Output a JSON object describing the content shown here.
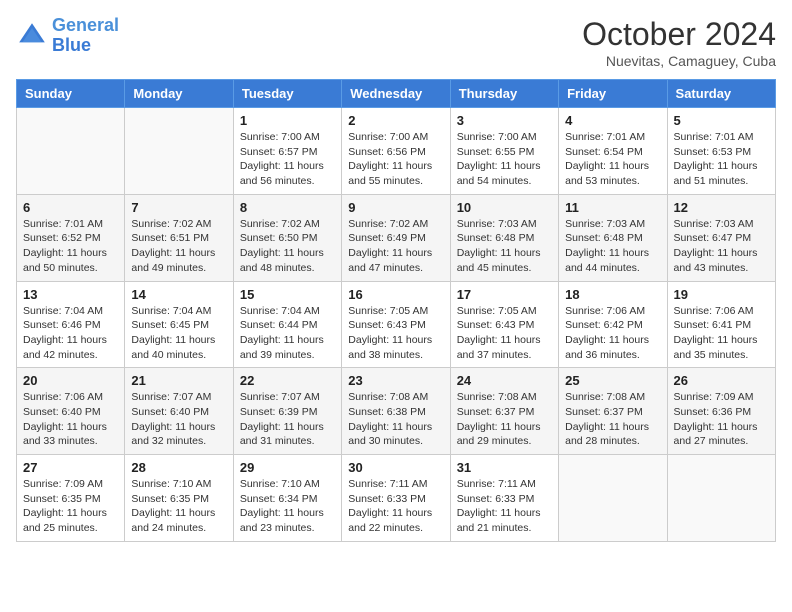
{
  "header": {
    "logo_line1": "General",
    "logo_line2": "Blue",
    "month": "October 2024",
    "location": "Nuevitas, Camaguey, Cuba"
  },
  "weekdays": [
    "Sunday",
    "Monday",
    "Tuesday",
    "Wednesday",
    "Thursday",
    "Friday",
    "Saturday"
  ],
  "weeks": [
    [
      {
        "day": "",
        "sunrise": "",
        "sunset": "",
        "daylight": ""
      },
      {
        "day": "",
        "sunrise": "",
        "sunset": "",
        "daylight": ""
      },
      {
        "day": "1",
        "sunrise": "Sunrise: 7:00 AM",
        "sunset": "Sunset: 6:57 PM",
        "daylight": "Daylight: 11 hours and 56 minutes."
      },
      {
        "day": "2",
        "sunrise": "Sunrise: 7:00 AM",
        "sunset": "Sunset: 6:56 PM",
        "daylight": "Daylight: 11 hours and 55 minutes."
      },
      {
        "day": "3",
        "sunrise": "Sunrise: 7:00 AM",
        "sunset": "Sunset: 6:55 PM",
        "daylight": "Daylight: 11 hours and 54 minutes."
      },
      {
        "day": "4",
        "sunrise": "Sunrise: 7:01 AM",
        "sunset": "Sunset: 6:54 PM",
        "daylight": "Daylight: 11 hours and 53 minutes."
      },
      {
        "day": "5",
        "sunrise": "Sunrise: 7:01 AM",
        "sunset": "Sunset: 6:53 PM",
        "daylight": "Daylight: 11 hours and 51 minutes."
      }
    ],
    [
      {
        "day": "6",
        "sunrise": "Sunrise: 7:01 AM",
        "sunset": "Sunset: 6:52 PM",
        "daylight": "Daylight: 11 hours and 50 minutes."
      },
      {
        "day": "7",
        "sunrise": "Sunrise: 7:02 AM",
        "sunset": "Sunset: 6:51 PM",
        "daylight": "Daylight: 11 hours and 49 minutes."
      },
      {
        "day": "8",
        "sunrise": "Sunrise: 7:02 AM",
        "sunset": "Sunset: 6:50 PM",
        "daylight": "Daylight: 11 hours and 48 minutes."
      },
      {
        "day": "9",
        "sunrise": "Sunrise: 7:02 AM",
        "sunset": "Sunset: 6:49 PM",
        "daylight": "Daylight: 11 hours and 47 minutes."
      },
      {
        "day": "10",
        "sunrise": "Sunrise: 7:03 AM",
        "sunset": "Sunset: 6:48 PM",
        "daylight": "Daylight: 11 hours and 45 minutes."
      },
      {
        "day": "11",
        "sunrise": "Sunrise: 7:03 AM",
        "sunset": "Sunset: 6:48 PM",
        "daylight": "Daylight: 11 hours and 44 minutes."
      },
      {
        "day": "12",
        "sunrise": "Sunrise: 7:03 AM",
        "sunset": "Sunset: 6:47 PM",
        "daylight": "Daylight: 11 hours and 43 minutes."
      }
    ],
    [
      {
        "day": "13",
        "sunrise": "Sunrise: 7:04 AM",
        "sunset": "Sunset: 6:46 PM",
        "daylight": "Daylight: 11 hours and 42 minutes."
      },
      {
        "day": "14",
        "sunrise": "Sunrise: 7:04 AM",
        "sunset": "Sunset: 6:45 PM",
        "daylight": "Daylight: 11 hours and 40 minutes."
      },
      {
        "day": "15",
        "sunrise": "Sunrise: 7:04 AM",
        "sunset": "Sunset: 6:44 PM",
        "daylight": "Daylight: 11 hours and 39 minutes."
      },
      {
        "day": "16",
        "sunrise": "Sunrise: 7:05 AM",
        "sunset": "Sunset: 6:43 PM",
        "daylight": "Daylight: 11 hours and 38 minutes."
      },
      {
        "day": "17",
        "sunrise": "Sunrise: 7:05 AM",
        "sunset": "Sunset: 6:43 PM",
        "daylight": "Daylight: 11 hours and 37 minutes."
      },
      {
        "day": "18",
        "sunrise": "Sunrise: 7:06 AM",
        "sunset": "Sunset: 6:42 PM",
        "daylight": "Daylight: 11 hours and 36 minutes."
      },
      {
        "day": "19",
        "sunrise": "Sunrise: 7:06 AM",
        "sunset": "Sunset: 6:41 PM",
        "daylight": "Daylight: 11 hours and 35 minutes."
      }
    ],
    [
      {
        "day": "20",
        "sunrise": "Sunrise: 7:06 AM",
        "sunset": "Sunset: 6:40 PM",
        "daylight": "Daylight: 11 hours and 33 minutes."
      },
      {
        "day": "21",
        "sunrise": "Sunrise: 7:07 AM",
        "sunset": "Sunset: 6:40 PM",
        "daylight": "Daylight: 11 hours and 32 minutes."
      },
      {
        "day": "22",
        "sunrise": "Sunrise: 7:07 AM",
        "sunset": "Sunset: 6:39 PM",
        "daylight": "Daylight: 11 hours and 31 minutes."
      },
      {
        "day": "23",
        "sunrise": "Sunrise: 7:08 AM",
        "sunset": "Sunset: 6:38 PM",
        "daylight": "Daylight: 11 hours and 30 minutes."
      },
      {
        "day": "24",
        "sunrise": "Sunrise: 7:08 AM",
        "sunset": "Sunset: 6:37 PM",
        "daylight": "Daylight: 11 hours and 29 minutes."
      },
      {
        "day": "25",
        "sunrise": "Sunrise: 7:08 AM",
        "sunset": "Sunset: 6:37 PM",
        "daylight": "Daylight: 11 hours and 28 minutes."
      },
      {
        "day": "26",
        "sunrise": "Sunrise: 7:09 AM",
        "sunset": "Sunset: 6:36 PM",
        "daylight": "Daylight: 11 hours and 27 minutes."
      }
    ],
    [
      {
        "day": "27",
        "sunrise": "Sunrise: 7:09 AM",
        "sunset": "Sunset: 6:35 PM",
        "daylight": "Daylight: 11 hours and 25 minutes."
      },
      {
        "day": "28",
        "sunrise": "Sunrise: 7:10 AM",
        "sunset": "Sunset: 6:35 PM",
        "daylight": "Daylight: 11 hours and 24 minutes."
      },
      {
        "day": "29",
        "sunrise": "Sunrise: 7:10 AM",
        "sunset": "Sunset: 6:34 PM",
        "daylight": "Daylight: 11 hours and 23 minutes."
      },
      {
        "day": "30",
        "sunrise": "Sunrise: 7:11 AM",
        "sunset": "Sunset: 6:33 PM",
        "daylight": "Daylight: 11 hours and 22 minutes."
      },
      {
        "day": "31",
        "sunrise": "Sunrise: 7:11 AM",
        "sunset": "Sunset: 6:33 PM",
        "daylight": "Daylight: 11 hours and 21 minutes."
      },
      {
        "day": "",
        "sunrise": "",
        "sunset": "",
        "daylight": ""
      },
      {
        "day": "",
        "sunrise": "",
        "sunset": "",
        "daylight": ""
      }
    ]
  ]
}
